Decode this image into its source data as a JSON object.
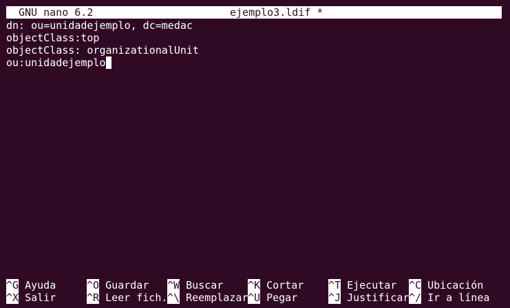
{
  "header": {
    "app_version": "GNU nano 6.2",
    "filename": "ejemplo3.ldif *"
  },
  "content": {
    "lines": [
      "dn: ou=unidadejemplo, dc=medac",
      "objectClass:top",
      "objectClass: organizationalUnit",
      "ou:unidadejemplo"
    ]
  },
  "shortcuts": {
    "row1": [
      {
        "key": "^G",
        "label": "Ayuda"
      },
      {
        "key": "^O",
        "label": "Guardar"
      },
      {
        "key": "^W",
        "label": "Buscar"
      },
      {
        "key": "^K",
        "label": "Cortar"
      },
      {
        "key": "^T",
        "label": "Ejecutar"
      },
      {
        "key": "^C",
        "label": "Ubicación"
      }
    ],
    "row2": [
      {
        "key": "^X",
        "label": "Salir"
      },
      {
        "key": "^R",
        "label": "Leer fich."
      },
      {
        "key": "^\\",
        "label": "Reemplazar"
      },
      {
        "key": "^U",
        "label": "Pegar"
      },
      {
        "key": "^J",
        "label": "Justificar"
      },
      {
        "key": "^/",
        "label": "Ir a línea"
      }
    ]
  }
}
